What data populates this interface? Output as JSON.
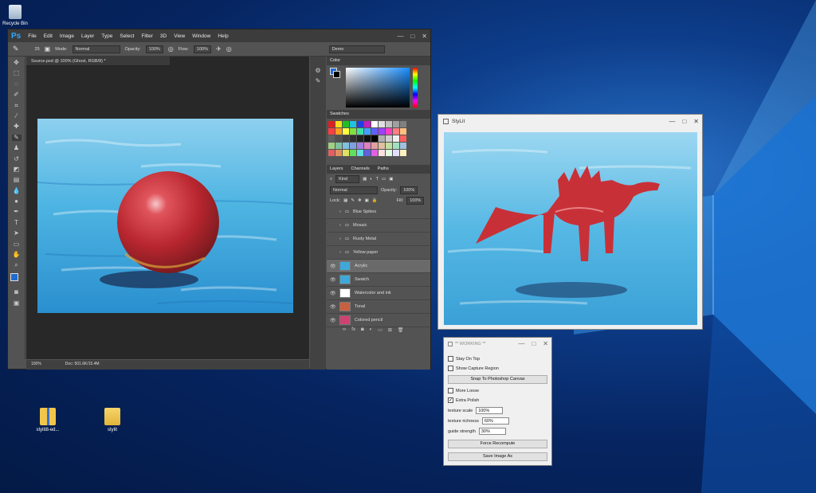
{
  "desktop": {
    "icons": [
      {
        "label": "Recycle Bin"
      },
      {
        "label": "stylit8-ed..."
      },
      {
        "label": "stylit"
      }
    ]
  },
  "photoshop": {
    "logo": "Ps",
    "menu": [
      "File",
      "Edit",
      "Image",
      "Layer",
      "Type",
      "Select",
      "Filter",
      "3D",
      "View",
      "Window",
      "Help"
    ],
    "window_controls": [
      "—",
      "□",
      "✕"
    ],
    "options": {
      "mode_label": "Mode:",
      "mode_value": "Normal",
      "opacity_label": "Opacity:",
      "opacity_value": "100%",
      "flow_label": "Flow:",
      "flow_value": "100%",
      "brush_size": "25",
      "workspace": "Demo"
    },
    "doc_tab": "Source.psd @ 100% (Ghost, RGB/8) *",
    "status": {
      "zoom": "100%",
      "doc": "Doc: 501.6K/15.4M"
    },
    "panels": {
      "color_title": "Color",
      "swatches_title": "Swatches",
      "layer_tabs": [
        "Layers",
        "Channels",
        "Paths"
      ],
      "kind_label": "Kind",
      "blend_value": "Normal",
      "opacity_label": "Opacity:",
      "opacity_value": "100%",
      "lock_label": "Lock:",
      "fill_label": "Fill:",
      "fill_value": "100%",
      "layers": [
        {
          "name": "Blue Spikes",
          "type": "folder",
          "visible": false,
          "selected": false
        },
        {
          "name": "Mosaic",
          "type": "folder",
          "visible": false,
          "selected": false
        },
        {
          "name": "Rusty Metal",
          "type": "folder",
          "visible": false,
          "selected": false
        },
        {
          "name": "Yellow paper",
          "type": "folder",
          "visible": false,
          "selected": false
        },
        {
          "name": "Acrylic",
          "type": "layer",
          "visible": true,
          "selected": true
        },
        {
          "name": "Swatch",
          "type": "layer",
          "visible": true,
          "selected": false
        },
        {
          "name": "Watercolor and ink",
          "type": "layer",
          "visible": true,
          "selected": false
        },
        {
          "name": "Tonal",
          "type": "layer",
          "visible": true,
          "selected": false
        },
        {
          "name": "Colored pencil",
          "type": "layer",
          "visible": true,
          "selected": false
        }
      ]
    }
  },
  "stylit": {
    "title": "StyLit",
    "window_controls": [
      "—",
      "□",
      "✕"
    ]
  },
  "working": {
    "title": "** WORKING **",
    "window_controls": [
      "—",
      "□",
      "✕"
    ],
    "stay_on_top": "Stay On Top",
    "show_capture": "Show Capture Region",
    "snap_button": "Snap To Photoshop Canvas",
    "more_loose": "More Loose",
    "extra_polish": "Extra Polish",
    "texture_scale_label": "texture scale",
    "texture_scale_value": "100%",
    "texture_richness_label": "texture richness",
    "texture_richness_value": "60%",
    "guide_strength_label": "guide strength",
    "guide_strength_value": "30%",
    "force_button": "Force Recompute",
    "save_button": "Save Image As"
  },
  "colors": {
    "ps_accent": "#31a8ff",
    "foreground": "#1f6bd1",
    "sphere": "#c8323a",
    "water": "#3fa8d8"
  }
}
